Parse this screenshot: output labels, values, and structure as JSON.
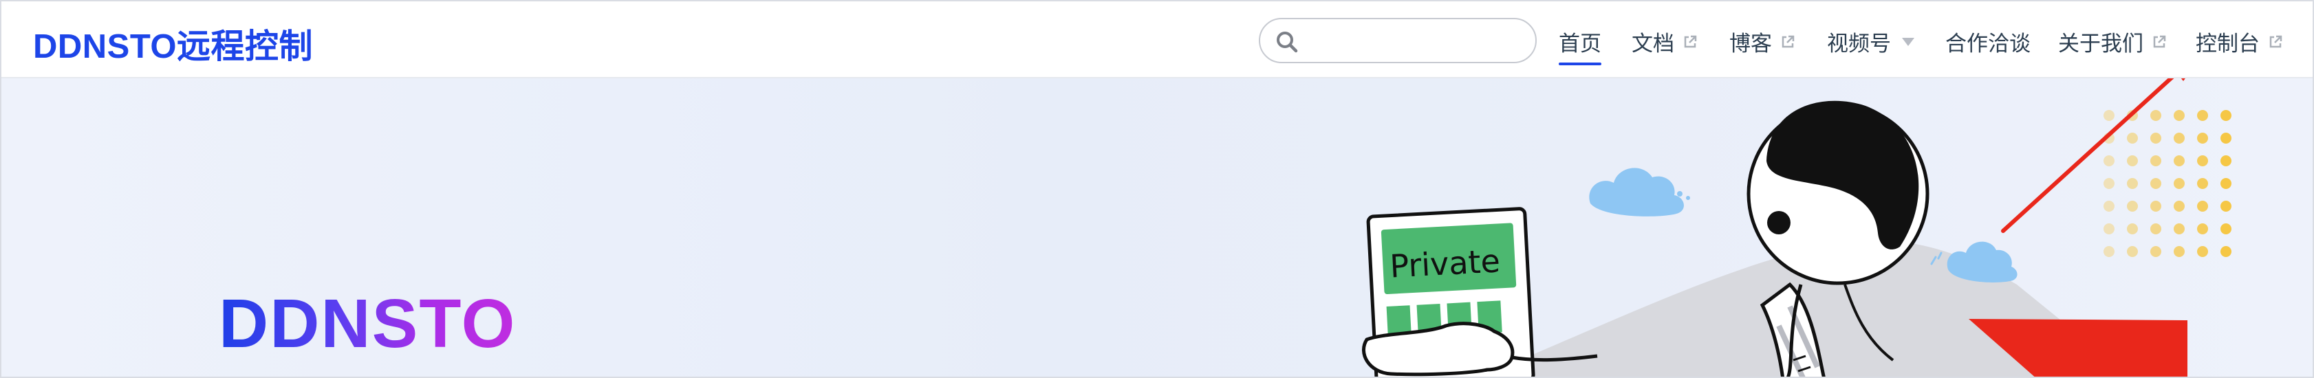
{
  "brand": {
    "title": "DDNSTO远程控制"
  },
  "search": {
    "placeholder": "",
    "value": ""
  },
  "nav": {
    "items": [
      {
        "label": "首页",
        "active": true
      },
      {
        "label": "文档",
        "external": true
      },
      {
        "label": "博客",
        "external": true
      },
      {
        "label": "视频号",
        "dropdown": true
      },
      {
        "label": "合作洽谈"
      },
      {
        "label": "关于我们",
        "external": true
      },
      {
        "label": "控制台",
        "external": true
      }
    ]
  },
  "hero": {
    "title": "DDNSTO",
    "card_text": "Private"
  },
  "colors": {
    "brand": "#1d45e8",
    "title_start": "#1f3fe8",
    "title_end": "#c02de0",
    "card_green": "#4cb870",
    "arrow_red": "#e9271b",
    "cloud_blue": "#8ec6f3",
    "dot_yellow": "#f5c43b"
  }
}
